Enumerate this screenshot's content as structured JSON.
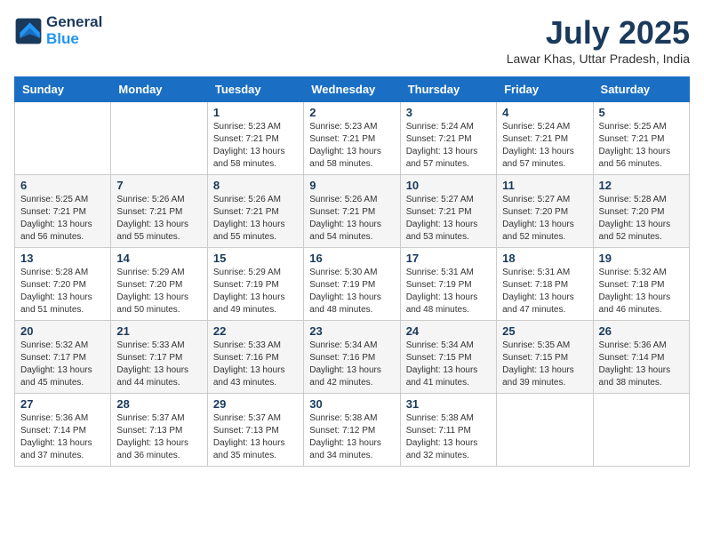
{
  "header": {
    "logo_line1": "General",
    "logo_line2": "Blue",
    "month": "July 2025",
    "location": "Lawar Khas, Uttar Pradesh, India"
  },
  "weekdays": [
    "Sunday",
    "Monday",
    "Tuesday",
    "Wednesday",
    "Thursday",
    "Friday",
    "Saturday"
  ],
  "weeks": [
    [
      {
        "day": "",
        "info": ""
      },
      {
        "day": "",
        "info": ""
      },
      {
        "day": "1",
        "info": "Sunrise: 5:23 AM\nSunset: 7:21 PM\nDaylight: 13 hours and 58 minutes."
      },
      {
        "day": "2",
        "info": "Sunrise: 5:23 AM\nSunset: 7:21 PM\nDaylight: 13 hours and 58 minutes."
      },
      {
        "day": "3",
        "info": "Sunrise: 5:24 AM\nSunset: 7:21 PM\nDaylight: 13 hours and 57 minutes."
      },
      {
        "day": "4",
        "info": "Sunrise: 5:24 AM\nSunset: 7:21 PM\nDaylight: 13 hours and 57 minutes."
      },
      {
        "day": "5",
        "info": "Sunrise: 5:25 AM\nSunset: 7:21 PM\nDaylight: 13 hours and 56 minutes."
      }
    ],
    [
      {
        "day": "6",
        "info": "Sunrise: 5:25 AM\nSunset: 7:21 PM\nDaylight: 13 hours and 56 minutes."
      },
      {
        "day": "7",
        "info": "Sunrise: 5:26 AM\nSunset: 7:21 PM\nDaylight: 13 hours and 55 minutes."
      },
      {
        "day": "8",
        "info": "Sunrise: 5:26 AM\nSunset: 7:21 PM\nDaylight: 13 hours and 55 minutes."
      },
      {
        "day": "9",
        "info": "Sunrise: 5:26 AM\nSunset: 7:21 PM\nDaylight: 13 hours and 54 minutes."
      },
      {
        "day": "10",
        "info": "Sunrise: 5:27 AM\nSunset: 7:21 PM\nDaylight: 13 hours and 53 minutes."
      },
      {
        "day": "11",
        "info": "Sunrise: 5:27 AM\nSunset: 7:20 PM\nDaylight: 13 hours and 52 minutes."
      },
      {
        "day": "12",
        "info": "Sunrise: 5:28 AM\nSunset: 7:20 PM\nDaylight: 13 hours and 52 minutes."
      }
    ],
    [
      {
        "day": "13",
        "info": "Sunrise: 5:28 AM\nSunset: 7:20 PM\nDaylight: 13 hours and 51 minutes."
      },
      {
        "day": "14",
        "info": "Sunrise: 5:29 AM\nSunset: 7:20 PM\nDaylight: 13 hours and 50 minutes."
      },
      {
        "day": "15",
        "info": "Sunrise: 5:29 AM\nSunset: 7:19 PM\nDaylight: 13 hours and 49 minutes."
      },
      {
        "day": "16",
        "info": "Sunrise: 5:30 AM\nSunset: 7:19 PM\nDaylight: 13 hours and 48 minutes."
      },
      {
        "day": "17",
        "info": "Sunrise: 5:31 AM\nSunset: 7:19 PM\nDaylight: 13 hours and 48 minutes."
      },
      {
        "day": "18",
        "info": "Sunrise: 5:31 AM\nSunset: 7:18 PM\nDaylight: 13 hours and 47 minutes."
      },
      {
        "day": "19",
        "info": "Sunrise: 5:32 AM\nSunset: 7:18 PM\nDaylight: 13 hours and 46 minutes."
      }
    ],
    [
      {
        "day": "20",
        "info": "Sunrise: 5:32 AM\nSunset: 7:17 PM\nDaylight: 13 hours and 45 minutes."
      },
      {
        "day": "21",
        "info": "Sunrise: 5:33 AM\nSunset: 7:17 PM\nDaylight: 13 hours and 44 minutes."
      },
      {
        "day": "22",
        "info": "Sunrise: 5:33 AM\nSunset: 7:16 PM\nDaylight: 13 hours and 43 minutes."
      },
      {
        "day": "23",
        "info": "Sunrise: 5:34 AM\nSunset: 7:16 PM\nDaylight: 13 hours and 42 minutes."
      },
      {
        "day": "24",
        "info": "Sunrise: 5:34 AM\nSunset: 7:15 PM\nDaylight: 13 hours and 41 minutes."
      },
      {
        "day": "25",
        "info": "Sunrise: 5:35 AM\nSunset: 7:15 PM\nDaylight: 13 hours and 39 minutes."
      },
      {
        "day": "26",
        "info": "Sunrise: 5:36 AM\nSunset: 7:14 PM\nDaylight: 13 hours and 38 minutes."
      }
    ],
    [
      {
        "day": "27",
        "info": "Sunrise: 5:36 AM\nSunset: 7:14 PM\nDaylight: 13 hours and 37 minutes."
      },
      {
        "day": "28",
        "info": "Sunrise: 5:37 AM\nSunset: 7:13 PM\nDaylight: 13 hours and 36 minutes."
      },
      {
        "day": "29",
        "info": "Sunrise: 5:37 AM\nSunset: 7:13 PM\nDaylight: 13 hours and 35 minutes."
      },
      {
        "day": "30",
        "info": "Sunrise: 5:38 AM\nSunset: 7:12 PM\nDaylight: 13 hours and 34 minutes."
      },
      {
        "day": "31",
        "info": "Sunrise: 5:38 AM\nSunset: 7:11 PM\nDaylight: 13 hours and 32 minutes."
      },
      {
        "day": "",
        "info": ""
      },
      {
        "day": "",
        "info": ""
      }
    ]
  ]
}
